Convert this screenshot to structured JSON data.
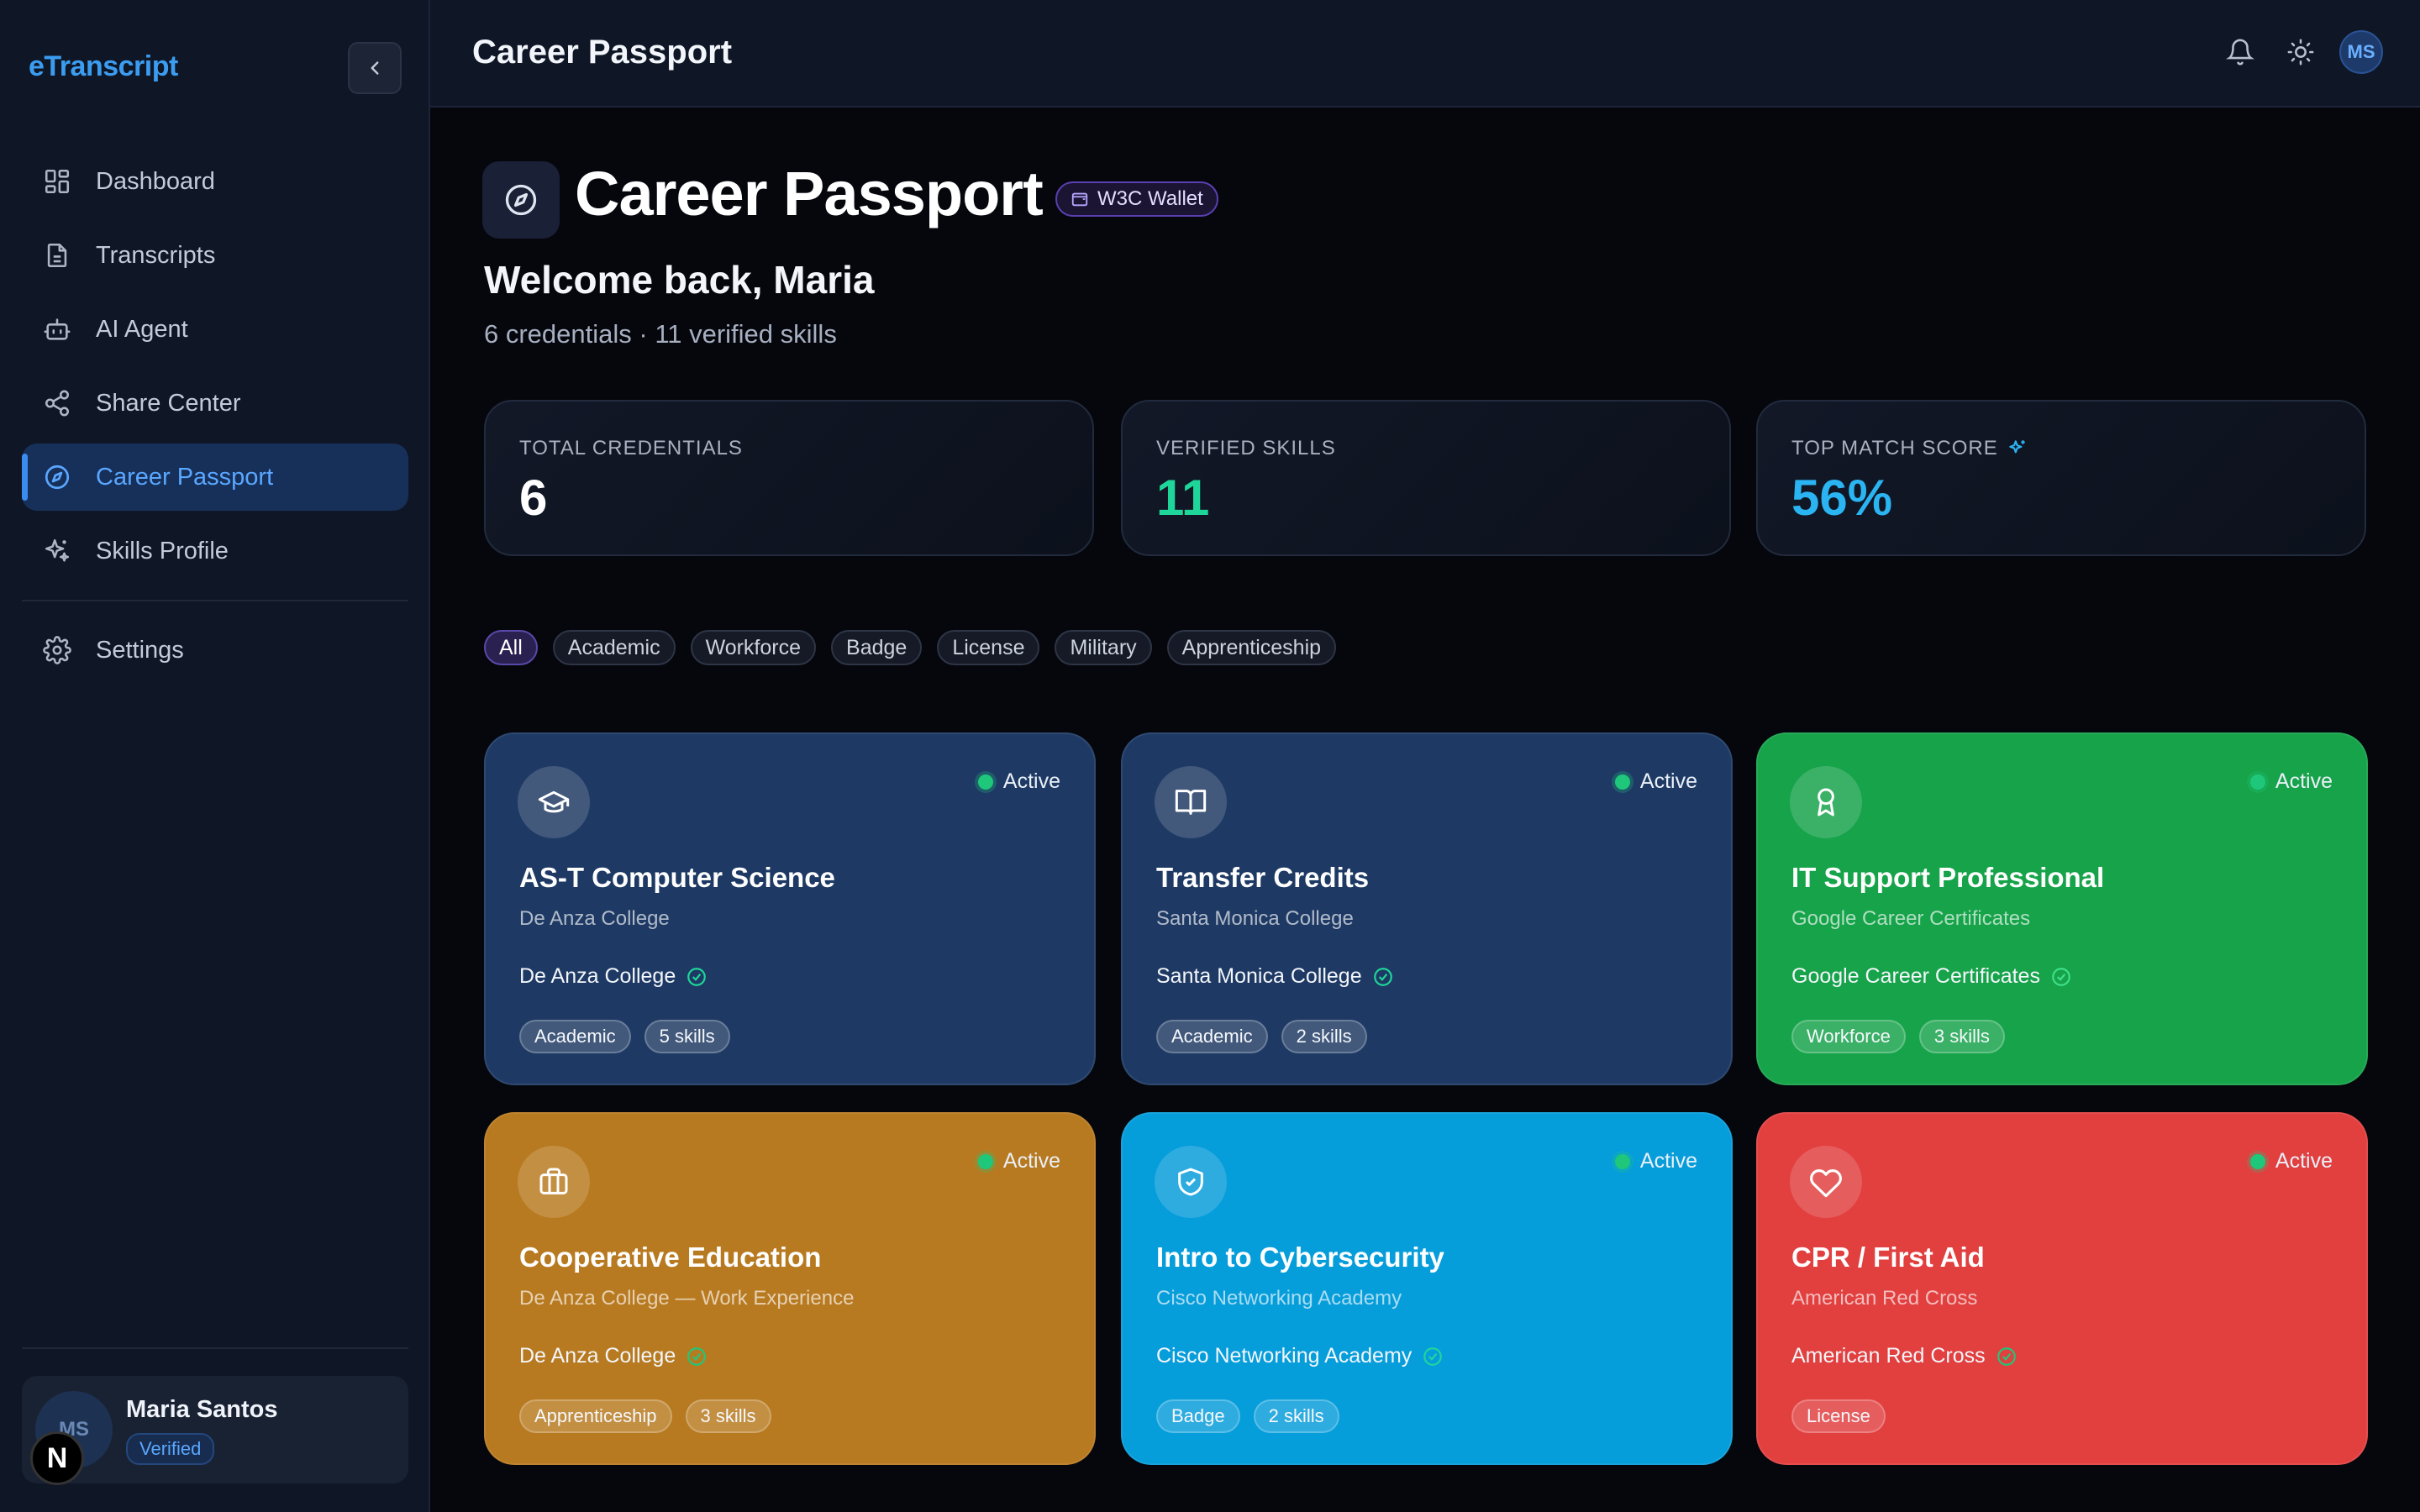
{
  "app": {
    "brand": "eTranscript"
  },
  "sidebar": {
    "items": [
      {
        "label": "Dashboard",
        "icon": "grid-icon"
      },
      {
        "label": "Transcripts",
        "icon": "document-icon"
      },
      {
        "label": "AI Agent",
        "icon": "bot-icon"
      },
      {
        "label": "Share Center",
        "icon": "share-icon"
      },
      {
        "label": "Career Passport",
        "icon": "compass-icon",
        "active": true
      },
      {
        "label": "Skills Profile",
        "icon": "sparkles-icon"
      }
    ],
    "settings_label": "Settings",
    "user": {
      "initials": "MS",
      "name": "Maria Santos",
      "status": "Verified",
      "dev_badge": "N"
    }
  },
  "topbar": {
    "title": "Career Passport",
    "avatar_initials": "MS"
  },
  "main": {
    "title": "Career Passport",
    "wallet_badge": "W3C Wallet",
    "welcome": "Welcome back, Maria",
    "subtitle": "6 credentials · 11 verified skills",
    "stats": [
      {
        "label": "TOTAL CREDENTIALS",
        "value": "6",
        "color": "#ffffff"
      },
      {
        "label": "VERIFIED SKILLS",
        "value": "11",
        "color": "#1fd69a"
      },
      {
        "label": "TOP MATCH SCORE",
        "value": "56%",
        "color": "#2bb4f2"
      }
    ],
    "filters": [
      "All",
      "Academic",
      "Workforce",
      "Badge",
      "License",
      "Military",
      "Apprenticeship"
    ],
    "cards": [
      {
        "title": "AS-T Computer Science",
        "issuer": "De Anza College",
        "verified_by": "De Anza College",
        "status": "Active",
        "type": "Academic",
        "skills": "5 skills",
        "icon": "graduation-cap-icon",
        "color": "#1e3a64"
      },
      {
        "title": "Transfer Credits",
        "issuer": "Santa Monica College",
        "verified_by": "Santa Monica College",
        "status": "Active",
        "type": "Academic",
        "skills": "2 skills",
        "icon": "book-open-icon",
        "color": "#1e3a64"
      },
      {
        "title": "IT Support Professional",
        "issuer": "Google Career Certificates",
        "verified_by": "Google Career Certificates",
        "status": "Active",
        "type": "Workforce",
        "skills": "3 skills",
        "icon": "award-icon",
        "color": "#16a34a"
      },
      {
        "title": "Cooperative Education",
        "issuer": "De Anza College — Work Experience",
        "verified_by": "De Anza College",
        "status": "Active",
        "type": "Apprenticeship",
        "skills": "3 skills",
        "icon": "briefcase-icon",
        "color": "#b87a20"
      },
      {
        "title": "Intro to Cybersecurity",
        "issuer": "Cisco Networking Academy",
        "verified_by": "Cisco Networking Academy",
        "status": "Active",
        "type": "Badge",
        "skills": "2 skills",
        "icon": "shield-check-icon",
        "color": "#069ddb"
      },
      {
        "title": "CPR / First Aid",
        "issuer": "American Red Cross",
        "verified_by": "American Red Cross",
        "status": "Active",
        "type": "License",
        "skills": "",
        "icon": "heart-icon",
        "color": "#e23f3f"
      }
    ]
  }
}
